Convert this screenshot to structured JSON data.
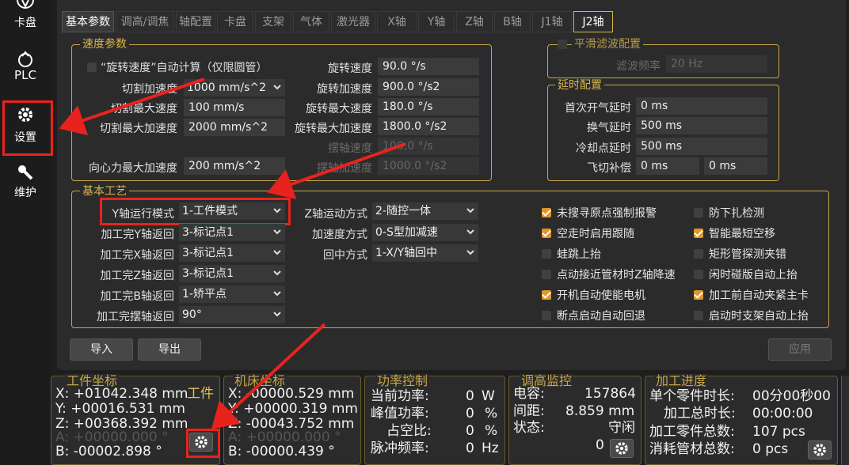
{
  "nav": {
    "cardisk": "卡盘",
    "plc": "PLC",
    "settings": "设置",
    "maintain": "维护"
  },
  "tabs": [
    "基本参数",
    "调高/调焦",
    "轴配置",
    "卡盘",
    "支架",
    "气体",
    "激光器",
    "X轴",
    "Y轴",
    "Z轴",
    "B轴",
    "J1轴",
    "J2轴"
  ],
  "speed": {
    "title": "速度参数",
    "auto_calc": "“旋转速度”自动计算（仅限圆管）",
    "cut_acc_label": "切割加速度",
    "cut_acc": "1000 mm/s^2",
    "cut_max_speed_label": "切割最大速度",
    "cut_max_speed": "100 mm/s",
    "cut_max_acc_label": "切割最大加速度",
    "cut_max_acc": "2000 mm/s^2",
    "centripetal_label": "向心力最大加速度",
    "centripetal": "200 mm/s^2",
    "rot_speed_label": "旋转速度",
    "rot_speed": "90.0 °/s",
    "rot_acc_label": "旋转加速度",
    "rot_acc": "900.0 °/s2",
    "rot_max_speed_label": "旋转最大速度",
    "rot_max_speed": "180.0 °/s",
    "rot_max_acc_label": "旋转最大加速度",
    "rot_max_acc": "1800.0 °/s2",
    "swing_speed_label": "摆轴速度",
    "swing_speed": "100.0 °/s",
    "swing_acc_label": "摆轴加速度",
    "swing_acc": "1000.0 °/s2"
  },
  "smooth": {
    "title": "平滑滤波配置",
    "freq_label": "滤波频率",
    "freq": "20 Hz"
  },
  "delay": {
    "title": "延时配置",
    "first_label": "首次开气延时",
    "first": "0 ms",
    "change_label": "换气延时",
    "change": "500 ms",
    "cool_label": "冷却点延时",
    "cool": "500 ms",
    "fly_label": "飞切补偿",
    "fly_a": "0 ms",
    "fly_b": "0 ms"
  },
  "process": {
    "title": "基本工艺",
    "y_mode_label": "Y轴运行模式",
    "y_mode": "1-工件模式",
    "ret_y_label": "加工完Y轴返回",
    "ret_y": "3-标记点1",
    "ret_x_label": "加工完X轴返回",
    "ret_x": "3-标记点1",
    "ret_z_label": "加工完Z轴返回",
    "ret_z": "3-标记点1",
    "ret_b_label": "加工完B轴返回",
    "ret_b": "1-矫平点",
    "ret_swing_label": "加工完摆轴返回",
    "ret_swing": "90°",
    "z_mode_label": "Z轴运动方式",
    "z_mode": "2-随控一体",
    "acc_mode_label": "加速度方式",
    "acc_mode": "0-S型加减速",
    "center_label": "回中方式",
    "center": "1-X/Y轴回中",
    "checks": [
      {
        "label": "未搜寻原点强制报警",
        "on": true
      },
      {
        "label": "防下扎检测",
        "on": false
      },
      {
        "label": "空走时启用跟随",
        "on": true
      },
      {
        "label": "智能最短空移",
        "on": true
      },
      {
        "label": "蛙跳上抬",
        "on": false
      },
      {
        "label": "矩形管探测夹错",
        "on": false
      },
      {
        "label": "点动接近管材时Z轴降速",
        "on": false
      },
      {
        "label": "闲时碰版自动上抬",
        "on": false
      },
      {
        "label": "开机自动使能电机",
        "on": true
      },
      {
        "label": "加工前自动夹紧主卡",
        "on": true
      },
      {
        "label": "断点启动自动回退",
        "on": false
      },
      {
        "label": "启动时支架自动上抬",
        "on": false
      }
    ]
  },
  "buttons": {
    "import": "导入",
    "export": "导出",
    "apply": "应用"
  },
  "work": {
    "title": "工件坐标",
    "x": "X: +01042.348 mm",
    "tag": "工件",
    "y": "Y: +00016.531 mm",
    "z": "Z: +00368.392 mm",
    "a": "A: +00000.000 °",
    "b": "B:  -00002.898 °"
  },
  "machine": {
    "title": "机床坐标",
    "x": "X: -00000.529 mm",
    "y": "Y: +00000.319 mm",
    "z": "Z:  -00043.752 mm",
    "a": "A: +00000.000 °",
    "b": "B:  -00000.439 °"
  },
  "power": {
    "title": "功率控制",
    "cur_label": "当前功率:",
    "cur": "0",
    "cur_u": "W",
    "peak_label": "峰值功率:",
    "peak": "0",
    "peak_u": "%",
    "duty_label": "占空比:",
    "duty": "0",
    "duty_u": "%",
    "freq_label": "脉冲频率:",
    "freq": "0",
    "freq_u": "Hz"
  },
  "height": {
    "title": "调高监控",
    "cap_label": "电容:",
    "cap": "157864",
    "gap_label": "间距:",
    "gap": "8.859 mm",
    "state_label": "状态:",
    "state": "守闲",
    "count": "0"
  },
  "progress": {
    "title": "加工进度",
    "single_label": "单个零件时长:",
    "single": "00分00秒00",
    "total_label": "加工总时长:",
    "total": "00:00:00",
    "parts_label": "加工零件总数:",
    "parts": "107 pcs",
    "tube_label": "消耗管材总数:",
    "tube": "0 pcs"
  }
}
